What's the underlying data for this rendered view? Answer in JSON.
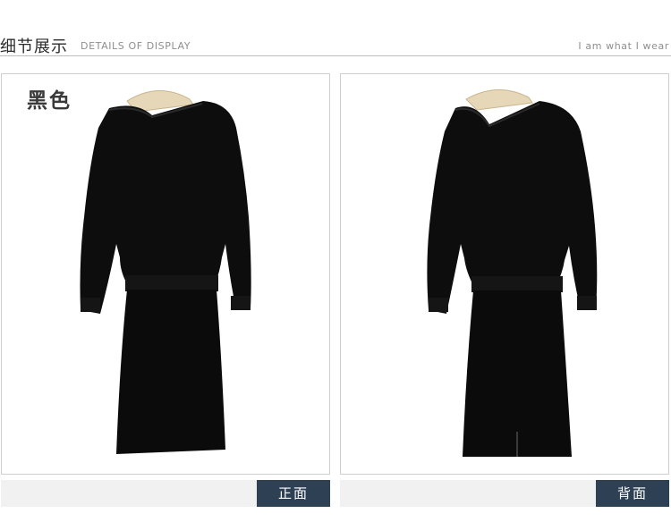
{
  "header": {
    "title_cn": "细节展示",
    "title_en": "DETAILS OF DISPLAY",
    "tagline": "I am what I wear"
  },
  "product": {
    "color_label": "黑色",
    "garment_color": "#0d0d0d",
    "hanger_color": "#e6d7b8"
  },
  "views": {
    "front_label": "正面",
    "back_label": "背面"
  },
  "colors": {
    "button_bg": "#2d4054",
    "strip_bg": "#f1f1f1"
  }
}
